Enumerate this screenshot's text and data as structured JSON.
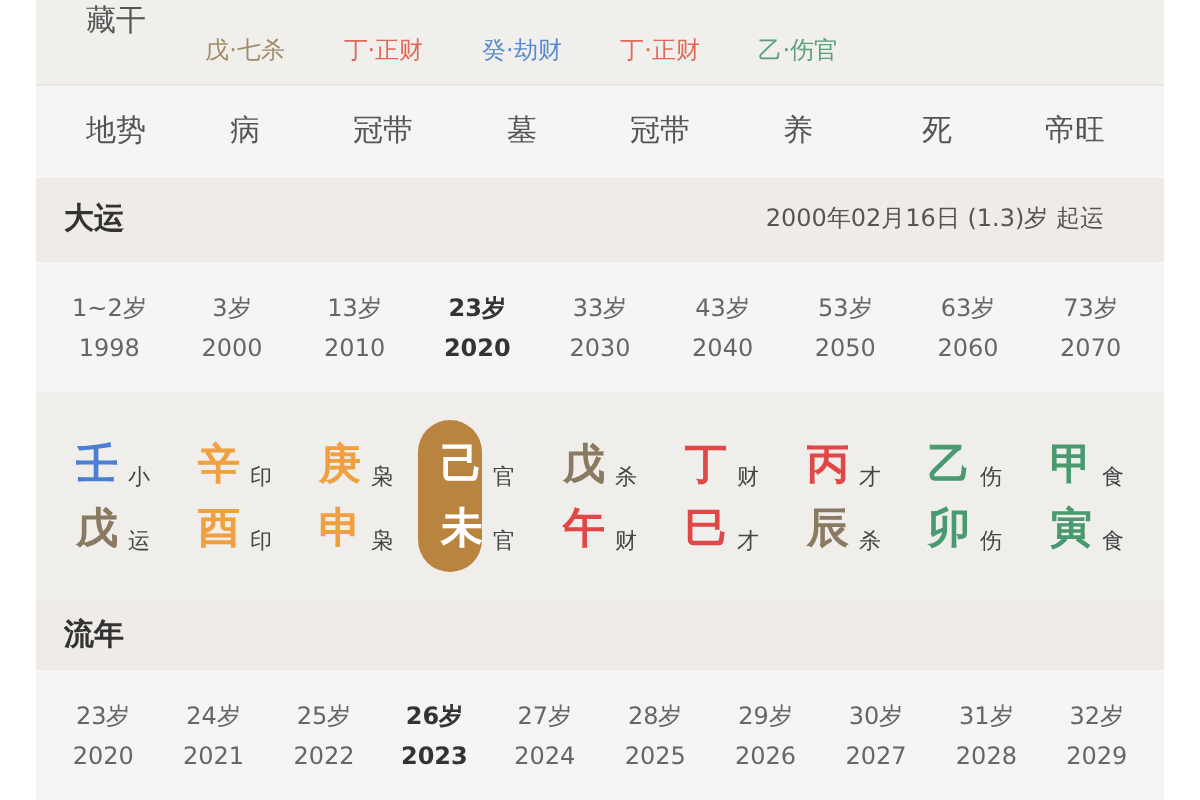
{
  "hidden_stems": {
    "label": "藏干",
    "items": [
      {
        "text": "戊·七杀",
        "color": "#a08c6a"
      },
      {
        "text": "丁·正财",
        "color": "#e06a5a"
      },
      {
        "text": "癸·劫财",
        "color": "#5a8ad0"
      },
      {
        "text": "丁·正财",
        "color": "#e06a5a"
      },
      {
        "text": "乙·伤官",
        "color": "#5aa07a"
      }
    ]
  },
  "terrain": {
    "label": "地势",
    "values": [
      "病",
      "冠带",
      "墓",
      "冠带",
      "养",
      "死",
      "帝旺"
    ]
  },
  "dayun": {
    "title": "大运",
    "start_info": "2000年02月16日 (1.3)岁 起运",
    "items": [
      {
        "age": "1~2岁",
        "year": "1998",
        "selected": false,
        "stem": {
          "char": "壬",
          "color": "#4a7fd4",
          "god": "小"
        },
        "branch": {
          "char": "戊",
          "color": "#8a7a62",
          "god": "运"
        }
      },
      {
        "age": "3岁",
        "year": "2000",
        "selected": false,
        "stem": {
          "char": "辛",
          "color": "#f0a040",
          "god": "印"
        },
        "branch": {
          "char": "酉",
          "color": "#f0a040",
          "god": "印"
        }
      },
      {
        "age": "13岁",
        "year": "2010",
        "selected": false,
        "stem": {
          "char": "庚",
          "color": "#f0a040",
          "god": "枭"
        },
        "branch": {
          "char": "申",
          "color": "#f0a040",
          "god": "枭"
        }
      },
      {
        "age": "23岁",
        "year": "2020",
        "selected": true,
        "stem": {
          "char": "己",
          "color": "#ffffff",
          "god": "官"
        },
        "branch": {
          "char": "未",
          "color": "#ffffff",
          "god": "官"
        }
      },
      {
        "age": "33岁",
        "year": "2030",
        "selected": false,
        "stem": {
          "char": "戊",
          "color": "#8a7a62",
          "god": "杀"
        },
        "branch": {
          "char": "午",
          "color": "#e04848",
          "god": "财"
        }
      },
      {
        "age": "43岁",
        "year": "2040",
        "selected": false,
        "stem": {
          "char": "丁",
          "color": "#e04848",
          "god": "财"
        },
        "branch": {
          "char": "巳",
          "color": "#e04848",
          "god": "才"
        }
      },
      {
        "age": "53岁",
        "year": "2050",
        "selected": false,
        "stem": {
          "char": "丙",
          "color": "#e04848",
          "god": "才"
        },
        "branch": {
          "char": "辰",
          "color": "#8a7a62",
          "god": "杀"
        }
      },
      {
        "age": "63岁",
        "year": "2060",
        "selected": false,
        "stem": {
          "char": "乙",
          "color": "#4a9a70",
          "god": "伤"
        },
        "branch": {
          "char": "卯",
          "color": "#4a9a70",
          "god": "伤"
        }
      },
      {
        "age": "73岁",
        "year": "2070",
        "selected": false,
        "stem": {
          "char": "甲",
          "color": "#4a9a70",
          "god": "食"
        },
        "branch": {
          "char": "寅",
          "color": "#4a9a70",
          "god": "食"
        }
      }
    ]
  },
  "liunian": {
    "title": "流年",
    "items": [
      {
        "age": "23岁",
        "year": "2020",
        "selected": false
      },
      {
        "age": "24岁",
        "year": "2021",
        "selected": false
      },
      {
        "age": "25岁",
        "year": "2022",
        "selected": false
      },
      {
        "age": "26岁",
        "year": "2023",
        "selected": true
      },
      {
        "age": "27岁",
        "year": "2024",
        "selected": false
      },
      {
        "age": "28岁",
        "year": "2025",
        "selected": false
      },
      {
        "age": "29岁",
        "year": "2026",
        "selected": false
      },
      {
        "age": "30岁",
        "year": "2027",
        "selected": false
      },
      {
        "age": "31岁",
        "year": "2028",
        "selected": false
      },
      {
        "age": "32岁",
        "year": "2029",
        "selected": false
      }
    ]
  }
}
